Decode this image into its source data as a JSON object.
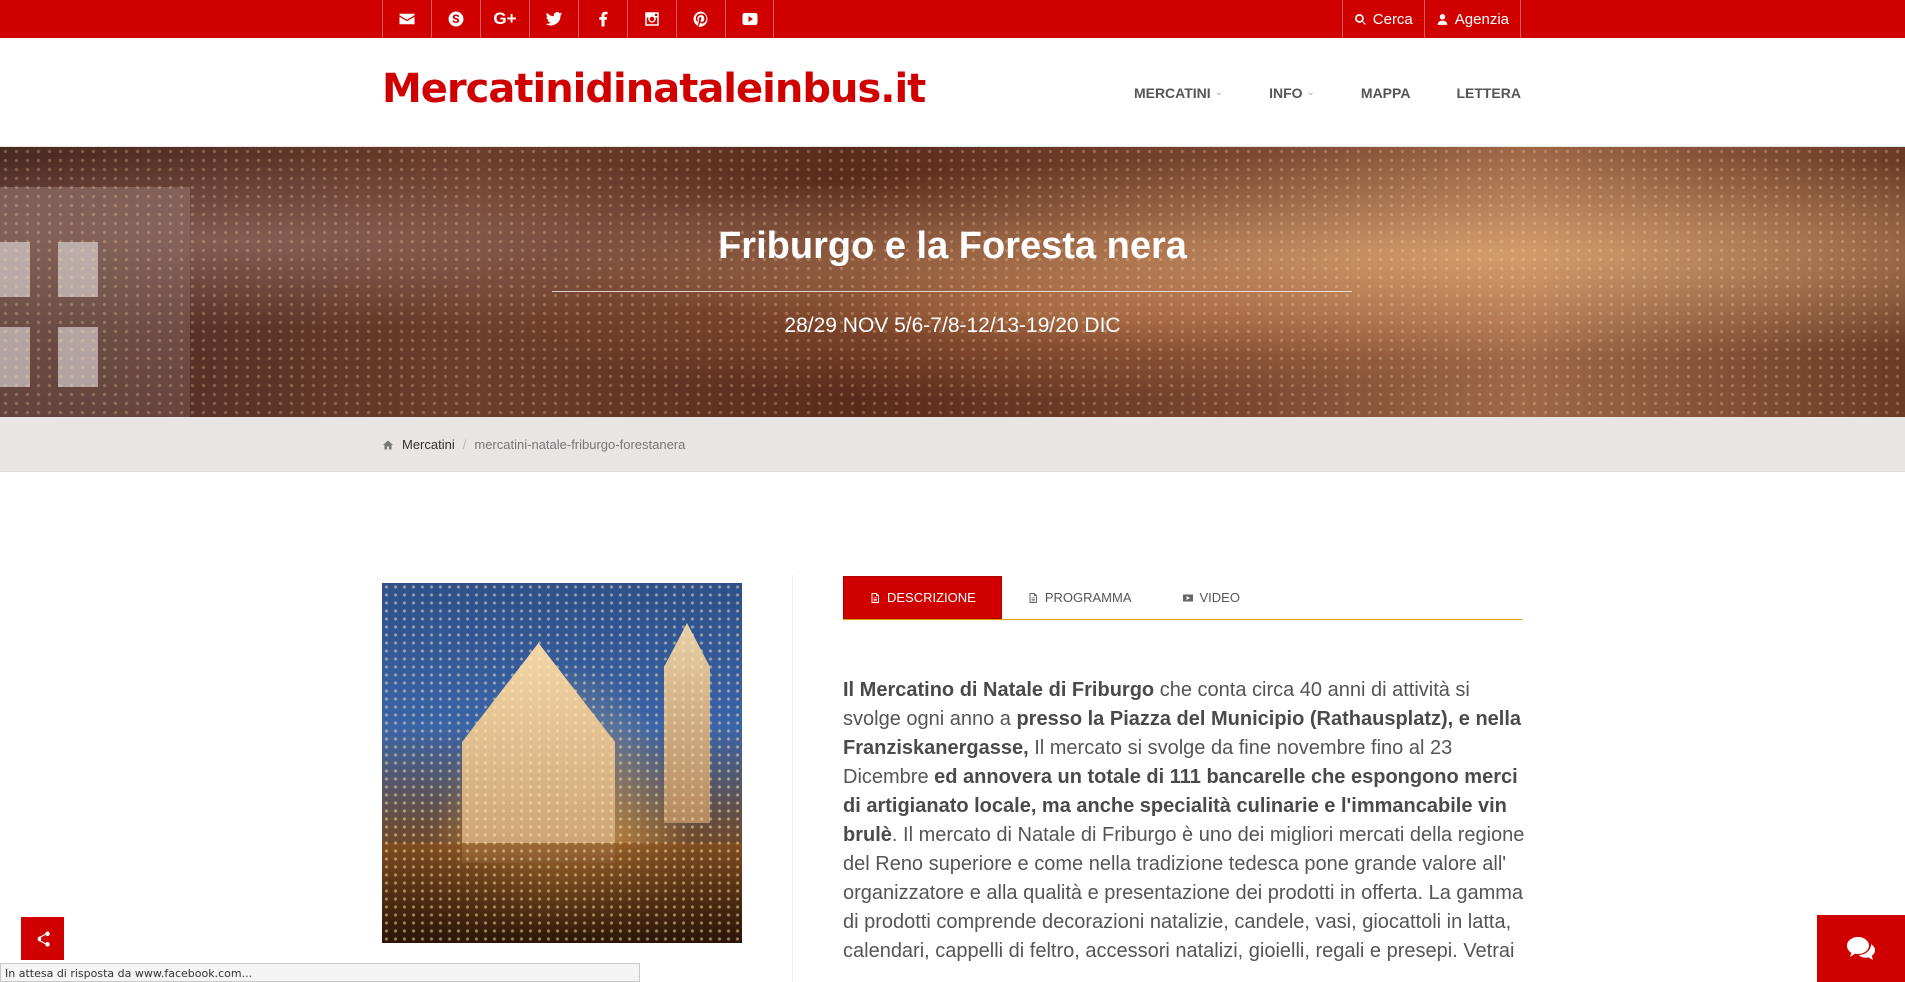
{
  "topbar": {
    "social": [
      {
        "icon": "envelope-icon"
      },
      {
        "icon": "skype-icon"
      },
      {
        "icon": "google-plus-icon",
        "text": "G+"
      },
      {
        "icon": "twitter-icon"
      },
      {
        "icon": "facebook-icon"
      },
      {
        "icon": "instagram-icon"
      },
      {
        "icon": "pinterest-icon"
      },
      {
        "icon": "youtube-icon"
      }
    ],
    "search_label": "Cerca",
    "agency_label": "Agenzia"
  },
  "header": {
    "logo": "Mercatinidinataleinbus.it",
    "nav": [
      {
        "label": "MERCATINI",
        "has_dropdown": true
      },
      {
        "label": "INFO",
        "has_dropdown": true
      },
      {
        "label": "MAPPA",
        "has_dropdown": false
      },
      {
        "label": "LETTERA",
        "has_dropdown": false
      }
    ]
  },
  "hero": {
    "title": "Friburgo e la Foresta nera",
    "dates": "28/29 NOV 5/6-7/8-12/13-19/20 DIC"
  },
  "breadcrumb": {
    "home": "Mercatini",
    "current": "mercatini-natale-friburgo-forestanera"
  },
  "tabs": [
    {
      "label": "DESCRIZIONE",
      "icon": "document-icon",
      "active": true
    },
    {
      "label": "PROGRAMMA",
      "icon": "document-icon",
      "active": false
    },
    {
      "label": "VIDEO",
      "icon": "video-icon",
      "active": false
    }
  ],
  "description": {
    "b1": "Il Mercatino di Natale di Friburgo",
    "t1": " che conta circa 40 anni di attività si svolge ogni anno a ",
    "b2": "presso la Piazza del Municipio (Rathausplatz), e nella Franziskanergasse,",
    "t2": " Il mercato si svolge da fine novembre fino al 23 Dicembre ",
    "b3": "ed annovera un totale di 111 bancarelle che espongono merci di artigianato locale, ma anche specialità culinarie e l'immancabile vin brulè",
    "t3": ". Il mercato di Natale di Friburgo è uno dei migliori mercati della regione del Reno superiore e come nella tradizione tedesca pone grande valore all' organizzatore e alla qualità e presentazione dei prodotti in offerta. La gamma di prodotti comprende decorazioni natalizie, candele, vasi, giocattoli in latta, calendari, cappelli di feltro, accessori natalizi, gioielli, regali e presepi. Vetrai"
  },
  "status_bar": "In attesa di risposta da www.facebook.com...",
  "colors": {
    "brand": "#d10000",
    "tab_underline": "#e0a400"
  }
}
